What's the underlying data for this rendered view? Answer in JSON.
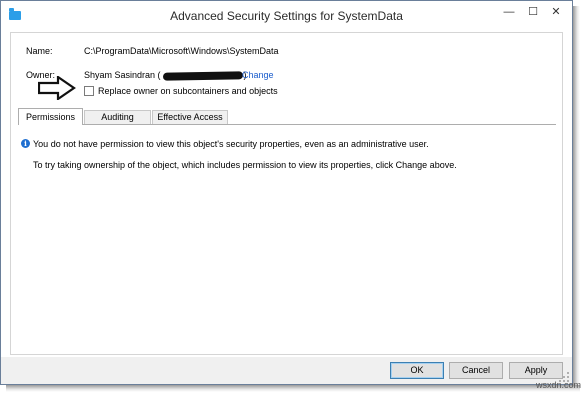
{
  "window": {
    "title": "Advanced Security Settings for SystemData",
    "controls": {
      "minimize": "—",
      "maximize": "☐",
      "close": "✕"
    }
  },
  "fields": {
    "name_label": "Name:",
    "name_value": "C:\\ProgramData\\Microsoft\\Windows\\SystemData",
    "owner_label": "Owner:",
    "owner_prefix": "Shyam Sasindran (",
    "owner_suffix": ")",
    "change_link": "Change",
    "replace_owner_label": "Replace owner on subcontainers and objects",
    "replace_owner_checked": false
  },
  "tabs": [
    {
      "label": "Permissions",
      "active": true
    },
    {
      "label": "Auditing",
      "active": false
    },
    {
      "label": "Effective Access",
      "active": false
    }
  ],
  "panel": {
    "icon": "info-icon",
    "message_1": "You do not have permission to view this object's security properties, even as an administrative user.",
    "message_2": "To try taking ownership of the object, which includes permission to view its properties, click Change above."
  },
  "buttons": {
    "ok": "OK",
    "cancel": "Cancel",
    "apply": "Apply"
  },
  "watermark": "wsxdn.com",
  "colors": {
    "link": "#1a5ccc",
    "info_icon": "#1f6fd0",
    "app_icon": "#2b9ee8"
  }
}
